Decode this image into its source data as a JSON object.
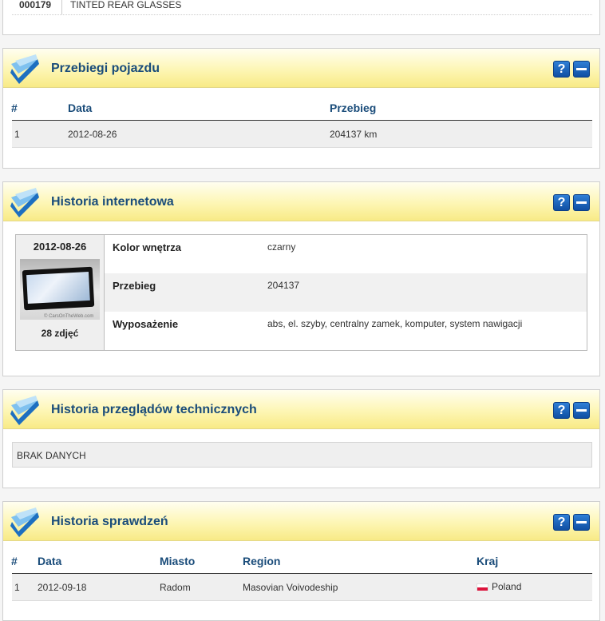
{
  "top_row": {
    "code": "000179",
    "text": "TINTED REAR GLASSES"
  },
  "icons": {
    "logo": "check-logo-icon",
    "help": "question-icon",
    "minimize": "minus-icon"
  },
  "colors": {
    "accent": "#1a4c7a",
    "header_yellow": "#fdf6b4",
    "button_blue": "#1a5fb4"
  },
  "help_label": "?",
  "mileage": {
    "title": "Przebiegi pojazdu",
    "columns": [
      "#",
      "Data",
      "Przebieg"
    ],
    "rows": [
      {
        "n": "1",
        "date": "2012-08-26",
        "value": "204137 km"
      }
    ]
  },
  "internet": {
    "title": "Historia internetowa",
    "date": "2012-08-26",
    "photo_caption": "© CarsOnTheWeb.com",
    "photo_count": "28 zdjęć",
    "rows": [
      {
        "label": "Kolor wnętrza",
        "value": "czarny"
      },
      {
        "label": "Przebieg",
        "value": "204137"
      },
      {
        "label": "Wyposażenie",
        "value": "abs, el. szyby, centralny zamek, komputer, system nawigacji"
      }
    ]
  },
  "inspections": {
    "title": "Historia przeglądów technicznych",
    "empty": "BRAK DANYCH"
  },
  "checks": {
    "title": "Historia sprawdzeń",
    "columns": [
      "#",
      "Data",
      "Miasto",
      "Region",
      "Kraj"
    ],
    "rows": [
      {
        "n": "1",
        "date": "2012-09-18",
        "city": "Radom",
        "region": "Masovian Voivodeship",
        "country": "Poland"
      }
    ]
  }
}
